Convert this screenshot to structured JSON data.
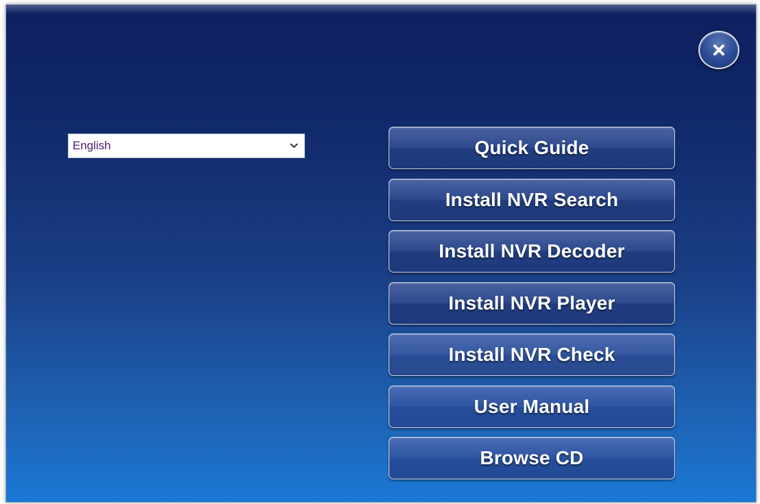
{
  "language": {
    "selected": "English"
  },
  "close": {
    "icon": "close-icon"
  },
  "menu": {
    "items": [
      {
        "label": "Quick Guide"
      },
      {
        "label": "Install NVR Search"
      },
      {
        "label": "Install NVR Decoder"
      },
      {
        "label": "Install NVR Player"
      },
      {
        "label": "Install NVR Check"
      },
      {
        "label": "User Manual"
      },
      {
        "label": "Browse CD"
      }
    ]
  },
  "colors": {
    "background_top": "#0e1f5e",
    "background_bottom": "#1a78d4",
    "button_text": "#ffffff",
    "select_text": "#4b1a6b"
  }
}
